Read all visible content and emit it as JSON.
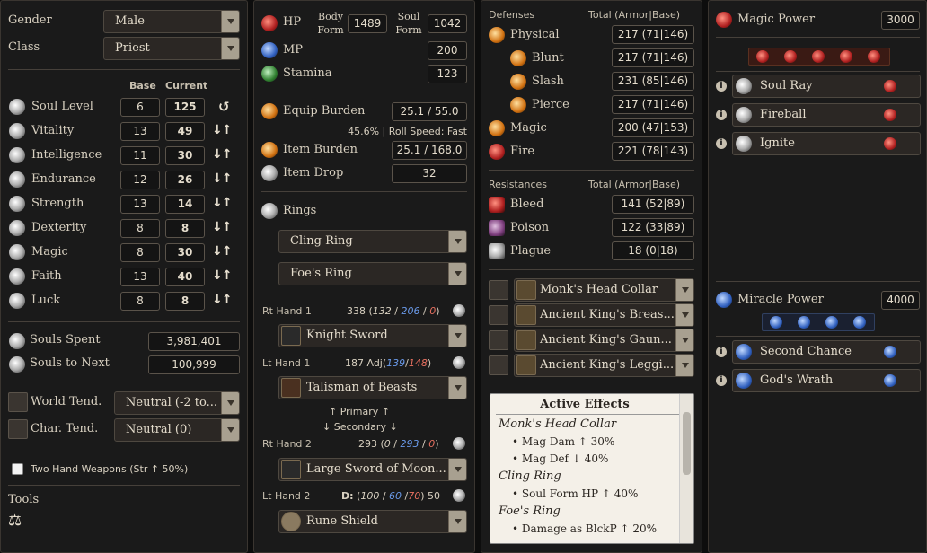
{
  "p1": {
    "gender_label": "Gender",
    "gender_value": "Male",
    "class_label": "Class",
    "class_value": "Priest",
    "base_hdr": "Base",
    "current_hdr": "Current",
    "stats": [
      {
        "name": "Soul Level",
        "base": "6",
        "current": "125",
        "icon": "soul-level-icon"
      },
      {
        "name": "Vitality",
        "base": "13",
        "current": "49",
        "icon": "vitality-icon"
      },
      {
        "name": "Intelligence",
        "base": "11",
        "current": "30",
        "icon": "intelligence-icon"
      },
      {
        "name": "Endurance",
        "base": "12",
        "current": "26",
        "icon": "endurance-icon"
      },
      {
        "name": "Strength",
        "base": "13",
        "current": "14",
        "icon": "strength-icon"
      },
      {
        "name": "Dexterity",
        "base": "8",
        "current": "8",
        "icon": "dexterity-icon"
      },
      {
        "name": "Magic",
        "base": "8",
        "current": "30",
        "icon": "magic-icon"
      },
      {
        "name": "Faith",
        "base": "13",
        "current": "40",
        "icon": "faith-icon"
      },
      {
        "name": "Luck",
        "base": "8",
        "current": "8",
        "icon": "luck-icon"
      }
    ],
    "arrows": "↓↑",
    "reset_glyph": "↺",
    "souls_spent_label": "Souls Spent",
    "souls_spent": "3,981,401",
    "souls_next_label": "Souls to Next",
    "souls_next": "100,999",
    "world_tend_label": "World Tend.",
    "world_tend": "Neutral (-2 to...",
    "char_tend_label": "Char. Tend.",
    "char_tend": "Neutral (0)",
    "two_hand_label": "Two Hand Weapons (Str ↑ 50%)",
    "tools_label": "Tools",
    "scale_glyph": "⚖"
  },
  "p2": {
    "hp_label": "HP",
    "body_form_label": "Body Form",
    "body_form_value": "1489",
    "soul_form_label": "Soul Form",
    "soul_form_value": "1042",
    "mp_label": "MP",
    "mp_value": "200",
    "stamina_label": "Stamina",
    "stamina_value": "123",
    "equip_burden_label": "Equip Burden",
    "equip_burden_value": "25.1 / 55.0",
    "burden_note": "45.6%  |  Roll Speed: Fast",
    "item_burden_label": "Item Burden",
    "item_burden_value": "25.1 / 168.0",
    "item_drop_label": "Item Drop",
    "item_drop_value": "32",
    "rings_label": "Rings",
    "ring1": "Cling Ring",
    "ring2": "Foe's Ring",
    "rh1_label": "Rt Hand 1",
    "rh1_total": "338",
    "rh1_a": "132",
    "rh1_b": "206",
    "rh1_c": "0",
    "rh1_weapon": "Knight Sword",
    "lh1_label": "Lt Hand 1",
    "lh1_prefix": "187 Adj",
    "lh1_a": "139",
    "lh1_b": "148",
    "lh1_weapon": "Talisman of Beasts",
    "primary_label": "↑ Primary ↑",
    "secondary_label": "↓ Secondary ↓",
    "rh2_label": "Rt Hand 2",
    "rh2_total": "293",
    "rh2_a": "0",
    "rh2_b": "293",
    "rh2_c": "0",
    "rh2_weapon": "Large Sword of Moon...",
    "lh2_label": "Lt Hand 2",
    "lh2_prefix": "D:",
    "lh2_a": "100",
    "lh2_b": "60",
    "lh2_c": "70",
    "lh2_d": "50",
    "lh2_weapon": "Rune Shield",
    "colors": {
      "blue": "#6a9aea",
      "red": "#e87060"
    }
  },
  "p3": {
    "def_hdr": "Defenses",
    "def_total_hdr": "Total (Armor|Base)",
    "defenses": [
      {
        "name": "Physical",
        "value": "217 (71|146)",
        "indent": false
      },
      {
        "name": "Blunt",
        "value": "217 (71|146)",
        "indent": true
      },
      {
        "name": "Slash",
        "value": "231 (85|146)",
        "indent": true
      },
      {
        "name": "Pierce",
        "value": "217 (71|146)",
        "indent": true
      },
      {
        "name": "Magic",
        "value": "200 (47|153)",
        "indent": false
      },
      {
        "name": "Fire",
        "value": "221 (78|143)",
        "indent": false
      }
    ],
    "res_hdr": "Resistances",
    "res_total_hdr": "Total (Armor|Base)",
    "resistances": [
      {
        "name": "Bleed",
        "value": "141 (52|89)"
      },
      {
        "name": "Poison",
        "value": "122 (33|89)"
      },
      {
        "name": "Plague",
        "value": "18 (0|18)"
      }
    ],
    "armor": [
      "Monk's Head Collar",
      "Ancient King's Breas...",
      "Ancient King's Gaun...",
      "Ancient King's Leggi..."
    ],
    "effects_title": "Active Effects",
    "effects": [
      {
        "kind": "h",
        "text": "Monk's Head Collar"
      },
      {
        "kind": "i",
        "text": "•  Mag Dam ↑ 30%"
      },
      {
        "kind": "i",
        "text": "•  Mag Def ↓ 40%"
      },
      {
        "kind": "h",
        "text": "Cling Ring"
      },
      {
        "kind": "i",
        "text": "•  Soul Form HP ↑ 40%"
      },
      {
        "kind": "h",
        "text": "Foe's Ring"
      },
      {
        "kind": "i",
        "text": "•  Damage as BlckP ↑ 20%"
      }
    ]
  },
  "p4": {
    "magic_power_label": "Magic Power",
    "magic_power_value": "3000",
    "spells": [
      "Soul Ray",
      "Fireball",
      "Ignite"
    ],
    "miracle_power_label": "Miracle Power",
    "miracle_power_value": "4000",
    "miracles": [
      "Second Chance",
      "God's Wrath"
    ],
    "info_glyph": "i"
  }
}
